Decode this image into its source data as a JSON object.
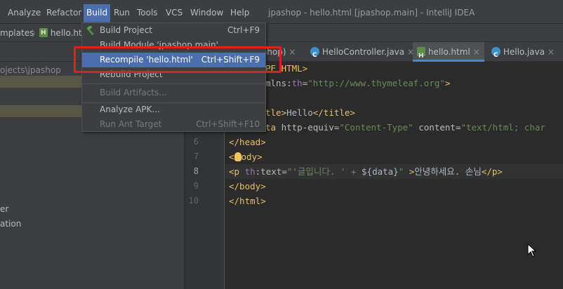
{
  "menubar": {
    "items": [
      "Analyze",
      "Refactor",
      "Build",
      "Run",
      "Tools",
      "VCS",
      "Window",
      "Help"
    ],
    "active": "Build",
    "window_title": "jpashop - hello.html [jpashop.main] - IntelliJ IDEA"
  },
  "navbar": {
    "crumb1": "mplates",
    "crumb2": "hello.htm"
  },
  "project": {
    "path": "ojects\\jpashop",
    "item_a": "er",
    "item_b": "ation"
  },
  "tabs": [
    {
      "label": "shop)",
      "icon": "",
      "active": false
    },
    {
      "label": "HelloController.java",
      "icon": "class-icon",
      "active": false
    },
    {
      "label": "hello.html",
      "icon": "html-file-icon",
      "active": true
    },
    {
      "label": "Hello.java",
      "icon": "class-icon",
      "active": false
    }
  ],
  "editor": {
    "line_numbers": [
      "6",
      "7",
      "8",
      "9",
      "10"
    ],
    "current_line": "8",
    "lines": {
      "l1_tail": "PE HTML>",
      "l2_tail": "mlns:",
      "l2_ns": "th",
      "l2_eq": "=",
      "l2_val": "\"http://www.thymeleaf.org\"",
      "l2_end": ">",
      "l4_a": "tle>",
      "l4_b": "Hello",
      "l4_c": "</title>",
      "l5_a": "ta ",
      "l5_b": "http-equiv",
      "l5_c": "=",
      "l5_d": "\"Content-Type\"",
      "l5_e": " content",
      "l5_f": "=",
      "l5_g": "\"text/html; char",
      "l6": "</head>",
      "l7_a": "<",
      "l7_b": "ody>",
      "l8_a": "<p ",
      "l8_ns": "th",
      "l8_b": ":text=",
      "l8_c": "\"'글입니다. ' + ",
      "l8_d": "${data}",
      "l8_e": "\"",
      "l8_f": " >",
      "l8_g": "안녕하세요. 손님",
      "l8_h": "</p>",
      "l9": "</body>",
      "l10": "</html>"
    }
  },
  "build_menu": {
    "items": [
      {
        "label": "Build Project",
        "shortcut": "Ctrl+F9",
        "state": "normal"
      },
      {
        "label": "Build Module 'jpashop.main'",
        "shortcut": "",
        "state": "normal"
      },
      {
        "label": "Recompile 'hello.html'",
        "shortcut": "Ctrl+Shift+F9",
        "state": "selected"
      },
      {
        "label": "Rebuild Project",
        "shortcut": "",
        "state": "normal"
      },
      {
        "label": "Build Artifacts...",
        "shortcut": "",
        "state": "disabled"
      },
      {
        "label": "Analyze APK...",
        "shortcut": "",
        "state": "normal"
      },
      {
        "label": "Run Ant Target",
        "shortcut": "Ctrl+Shift+F10",
        "state": "disabled"
      }
    ]
  },
  "colors": {
    "accent": "#4b6eaf",
    "highlight_box": "#e02020",
    "tab_underline": "#4a88c7"
  }
}
